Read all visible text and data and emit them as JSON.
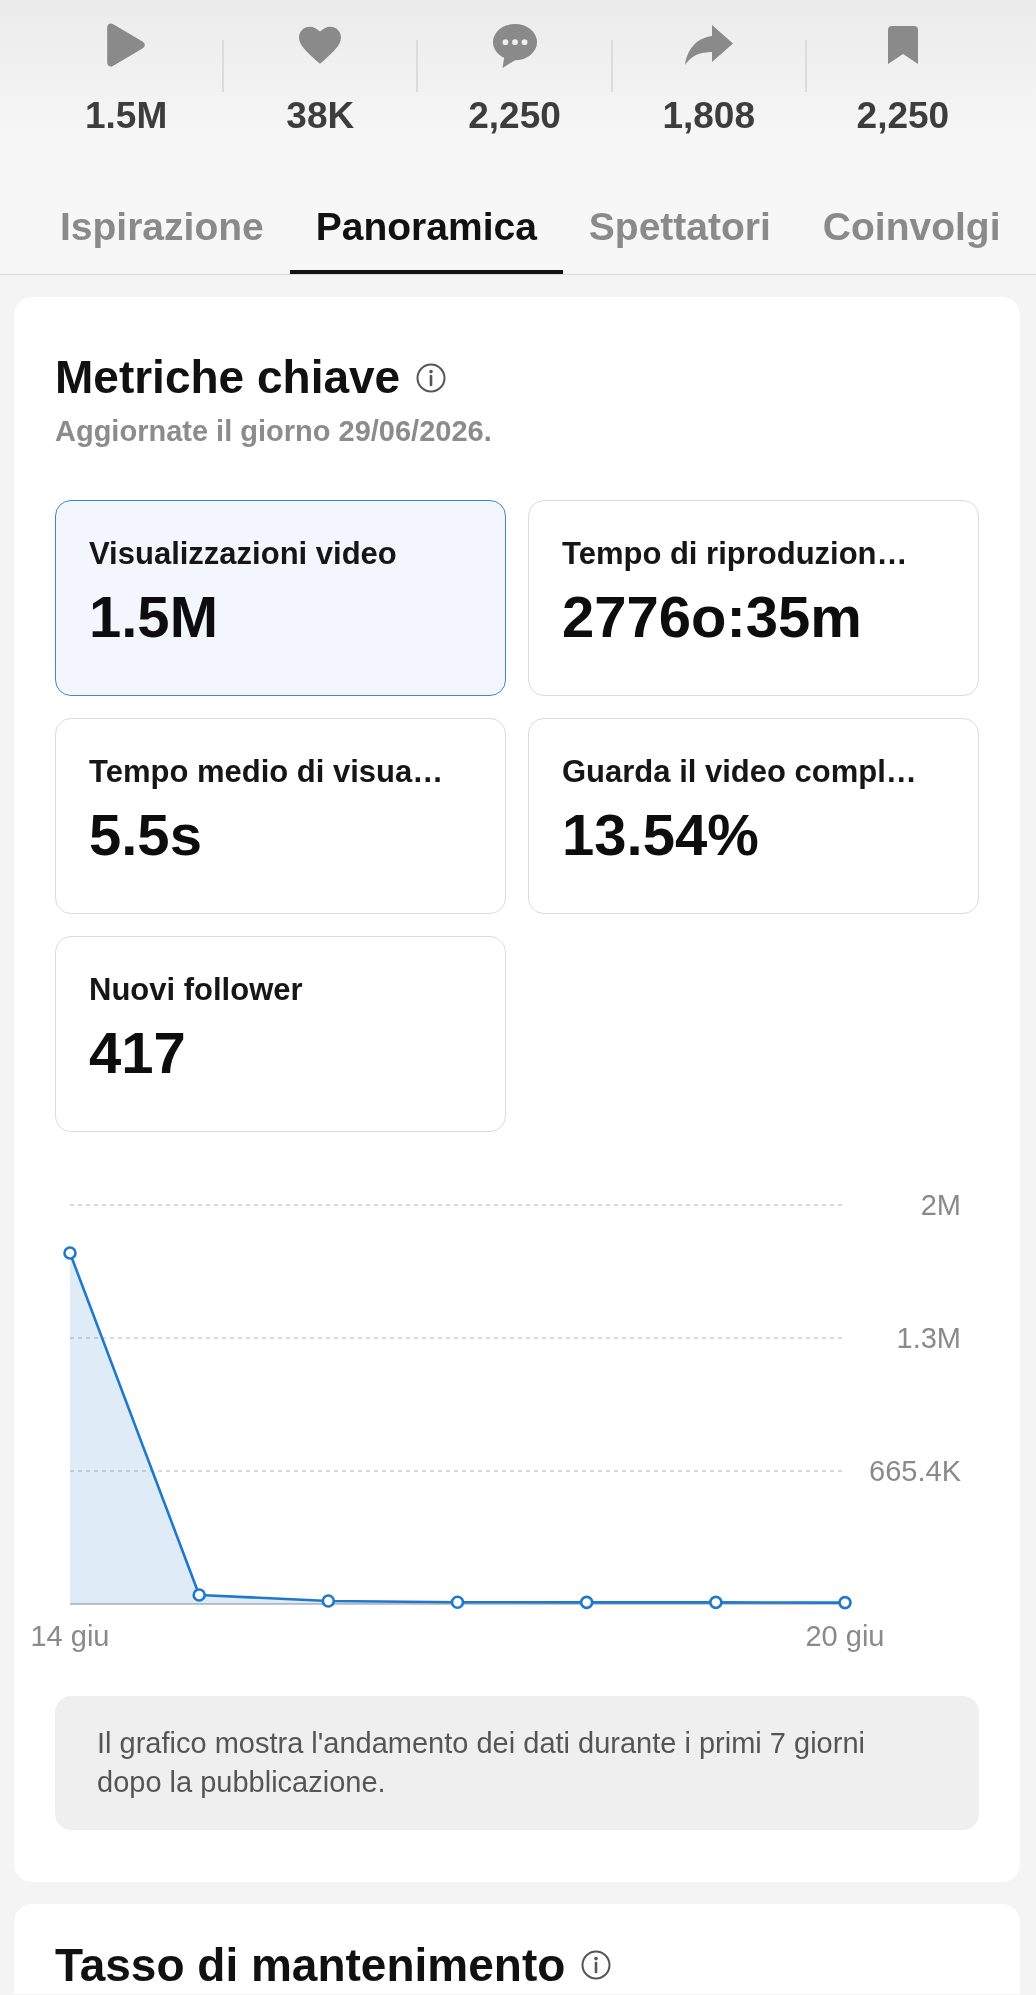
{
  "stats": [
    {
      "kind": "views",
      "value": "1.5M"
    },
    {
      "kind": "likes",
      "value": "38K"
    },
    {
      "kind": "comments",
      "value": "2,250"
    },
    {
      "kind": "shares",
      "value": "1,808"
    },
    {
      "kind": "saves",
      "value": "2,250"
    }
  ],
  "tabs": [
    {
      "label": "Ispirazione",
      "selected": false
    },
    {
      "label": "Panoramica",
      "selected": true
    },
    {
      "label": "Spettatori",
      "selected": false
    },
    {
      "label": "Coinvolgi",
      "selected": false
    }
  ],
  "key_metrics": {
    "title": "Metriche chiave",
    "updated": "Aggiornate il giorno 29/06/2026.",
    "metrics": [
      {
        "label": "Visualizzazioni video",
        "value": "1.5M",
        "selected": true
      },
      {
        "label": "Tempo di riproduzion…",
        "value": "2776o:35m",
        "selected": false
      },
      {
        "label": "Tempo medio di visua…",
        "value": "5.5s",
        "selected": false
      },
      {
        "label": "Guarda il video compl…",
        "value": "13.54%",
        "selected": false
      },
      {
        "label": "Nuovi follower",
        "value": "417",
        "selected": false
      }
    ],
    "chart_data": {
      "type": "area",
      "categories": [
        "14 giu",
        null,
        null,
        null,
        null,
        null,
        "20 giu"
      ],
      "ylim": [
        0,
        1996200
      ],
      "yticks": [
        {
          "value": 665400,
          "label": "665.4K"
        },
        {
          "value": 1330800,
          "label": "1.3M"
        },
        {
          "value": 1996200,
          "label": "2M"
        }
      ],
      "series": [
        {
          "color": "#1e78cc",
          "values": [
            1756000,
            45000,
            15000,
            9000,
            8000,
            8000,
            7000
          ]
        }
      ]
    },
    "note": "Il grafico mostra l'andamento dei dati durante i primi 7 giorni dopo la pubblicazione."
  },
  "retention": {
    "title": "Tasso di mantenimento"
  }
}
